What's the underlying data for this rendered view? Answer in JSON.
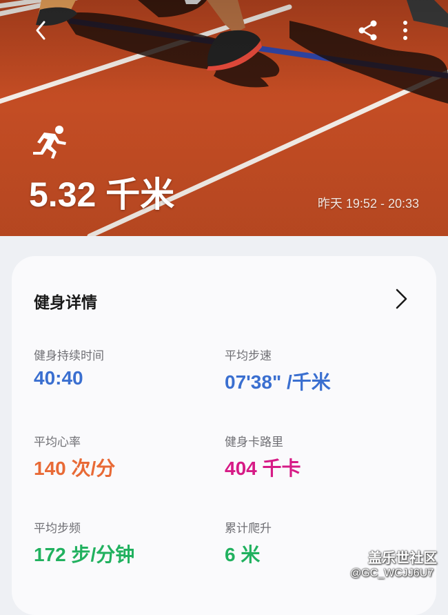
{
  "header": {
    "distance": "5.32 千米",
    "time_range": "昨天 19:52 - 20:33",
    "icons": {
      "back": "back-arrow-icon",
      "share": "share-icon",
      "more": "more-vert-icon",
      "activity": "running-icon"
    }
  },
  "card": {
    "title": "健身详情",
    "stats": [
      {
        "label": "健身持续时间",
        "value": "40:40",
        "color": "#3a6fd0"
      },
      {
        "label": "平均步速",
        "value": "07'38\" /千米",
        "color": "#3a6fd0"
      },
      {
        "label": "平均心率",
        "value": "140 次/分",
        "color": "#e86a36"
      },
      {
        "label": "健身卡路里",
        "value": "404 千卡",
        "color": "#d61b86"
      },
      {
        "label": "平均步频",
        "value": "172 步/分钟",
        "color": "#21b15f"
      },
      {
        "label": "累计爬升",
        "value": "6 米",
        "color": "#21b15f"
      }
    ]
  },
  "watermark": {
    "line1": "盖乐世社区",
    "line2": "@GC_WCJJ6U7"
  }
}
